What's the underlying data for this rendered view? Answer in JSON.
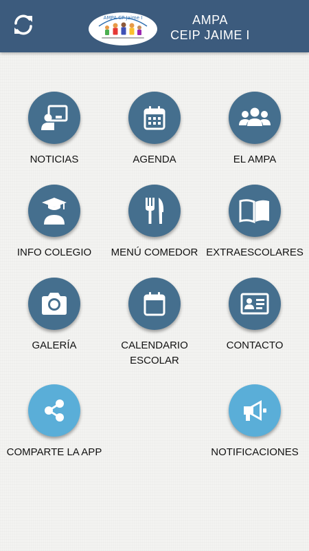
{
  "header": {
    "title_line1": "AMPA",
    "title_line2": "CEIP JAIME I",
    "logo_text": "AMPA CP Jaime I"
  },
  "colors": {
    "header_bg": "#3c5b7d",
    "circle_dark": "#456f8e",
    "circle_light": "#5aaed8"
  },
  "menu": [
    {
      "label": "NOTICIAS",
      "icon": "presentation-board-icon"
    },
    {
      "label": "AGENDA",
      "icon": "calendar-grid-icon"
    },
    {
      "label": "EL AMPA",
      "icon": "group-users-icon"
    },
    {
      "label": "INFO COLEGIO",
      "icon": "graduate-icon"
    },
    {
      "label": "MENÚ COMEDOR",
      "icon": "fork-knife-icon"
    },
    {
      "label": "EXTRAESCOLARES",
      "icon": "open-book-icon"
    },
    {
      "label": "GALERÍA",
      "icon": "camera-icon"
    },
    {
      "label": "CALENDARIO\nESCOLAR",
      "icon": "calendar-blank-icon"
    },
    {
      "label": "CONTACTO",
      "icon": "id-card-icon"
    },
    {
      "label": "COMPARTE LA APP",
      "icon": "share-icon"
    },
    {
      "label": "NOTIFICACIONES",
      "icon": "megaphone-icon"
    }
  ]
}
